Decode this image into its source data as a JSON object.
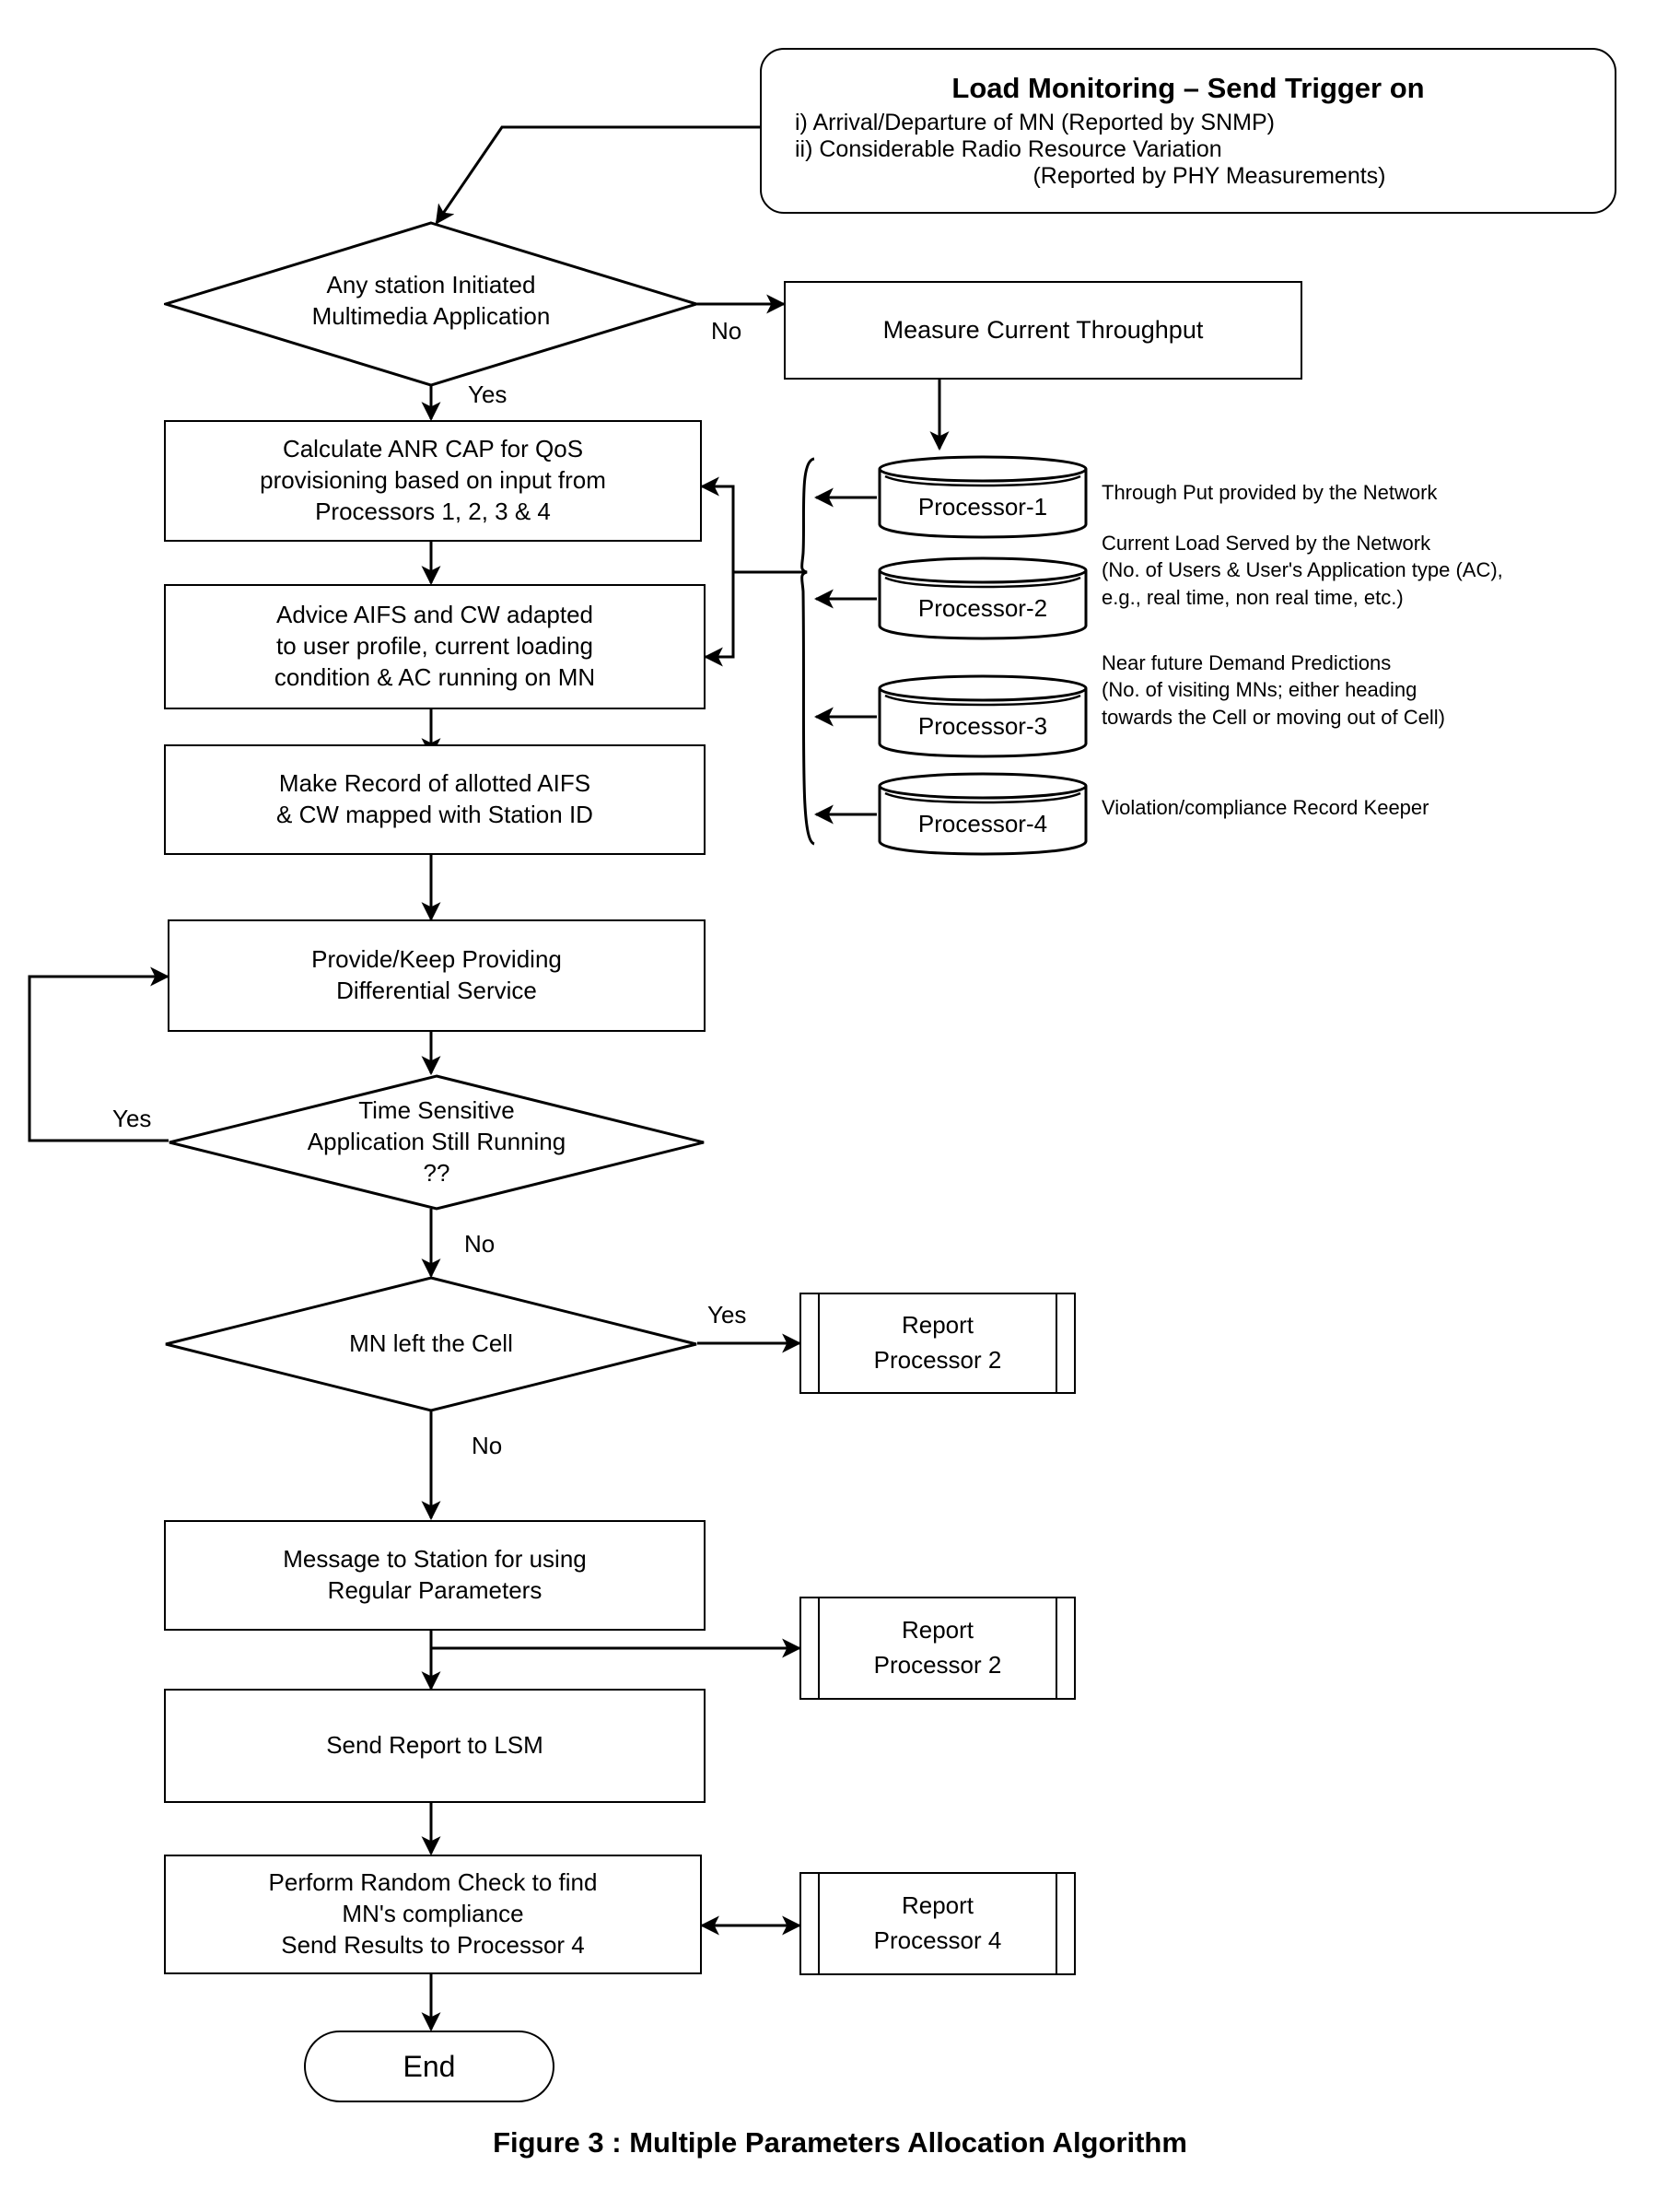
{
  "figure": {
    "caption": "Figure 3 : Multiple Parameters Allocation Algorithm"
  },
  "header": {
    "title": "Load Monitoring – Send Trigger on",
    "line1": "i)  Arrival/Departure of MN (Reported by SNMP)",
    "line2": "ii) Considerable Radio Resource Variation",
    "line3": "(Reported by PHY Measurements)"
  },
  "decisions": {
    "multimedia": {
      "line1": "Any station Initiated",
      "line2": "Multimedia Application",
      "yes_label": "Yes",
      "no_label": "No"
    },
    "time_sensitive": {
      "line1": "Time Sensitive",
      "line2": "Application Still Running",
      "line3": "??",
      "yes_label": "Yes",
      "no_label": "No"
    },
    "mn_left": {
      "line1": "MN left the Cell",
      "yes_label": "Yes",
      "no_label": "No"
    }
  },
  "processes": {
    "measure_throughput": {
      "line1": "Measure Current Throughput"
    },
    "calculate_anr": {
      "line1": "Calculate ANR CAP for QoS",
      "line2": "provisioning based on input from",
      "line3": "Processors 1, 2, 3 & 4"
    },
    "advice_aifs": {
      "line1": "Advice AIFS and CW adapted",
      "line2": "to user profile, current loading",
      "line3": "condition & AC running on MN"
    },
    "make_record": {
      "line1": "Make Record of allotted AIFS",
      "line2": "& CW mapped with Station ID"
    },
    "provide_service": {
      "line1": "Provide/Keep Providing",
      "line2": "Differential Service"
    },
    "message_station": {
      "line1": "Message to Station for using",
      "line2": "Regular Parameters"
    },
    "send_report_lsm": {
      "line1": "Send Report to LSM"
    },
    "random_check": {
      "line1": "Perform Random Check to find",
      "line2": "MN's compliance",
      "line3": "Send Results to Processor 4"
    }
  },
  "predefined": {
    "report_processor_2a": {
      "line1": "Report",
      "line2": "Processor 2"
    },
    "report_processor_2b": {
      "line1": "Report",
      "line2": "Processor 2"
    },
    "report_processor_4": {
      "line1": "Report",
      "line2": "Processor 4"
    }
  },
  "terminator": {
    "end": "End"
  },
  "processors": [
    {
      "name": "Processor-1",
      "description": "Through Put provided by the Network"
    },
    {
      "name": "Processor-2",
      "description": "Current Load Served by the Network\n(No. of Users & User's Application type (AC),\n     e.g., real time, non real time, etc.)"
    },
    {
      "name": "Processor-3",
      "description": "Near future Demand Predictions\n(No. of  visiting MNs; either heading\ntowards the Cell or moving out of Cell)"
    },
    {
      "name": "Processor-4",
      "description": "Violation/compliance Record Keeper"
    }
  ]
}
